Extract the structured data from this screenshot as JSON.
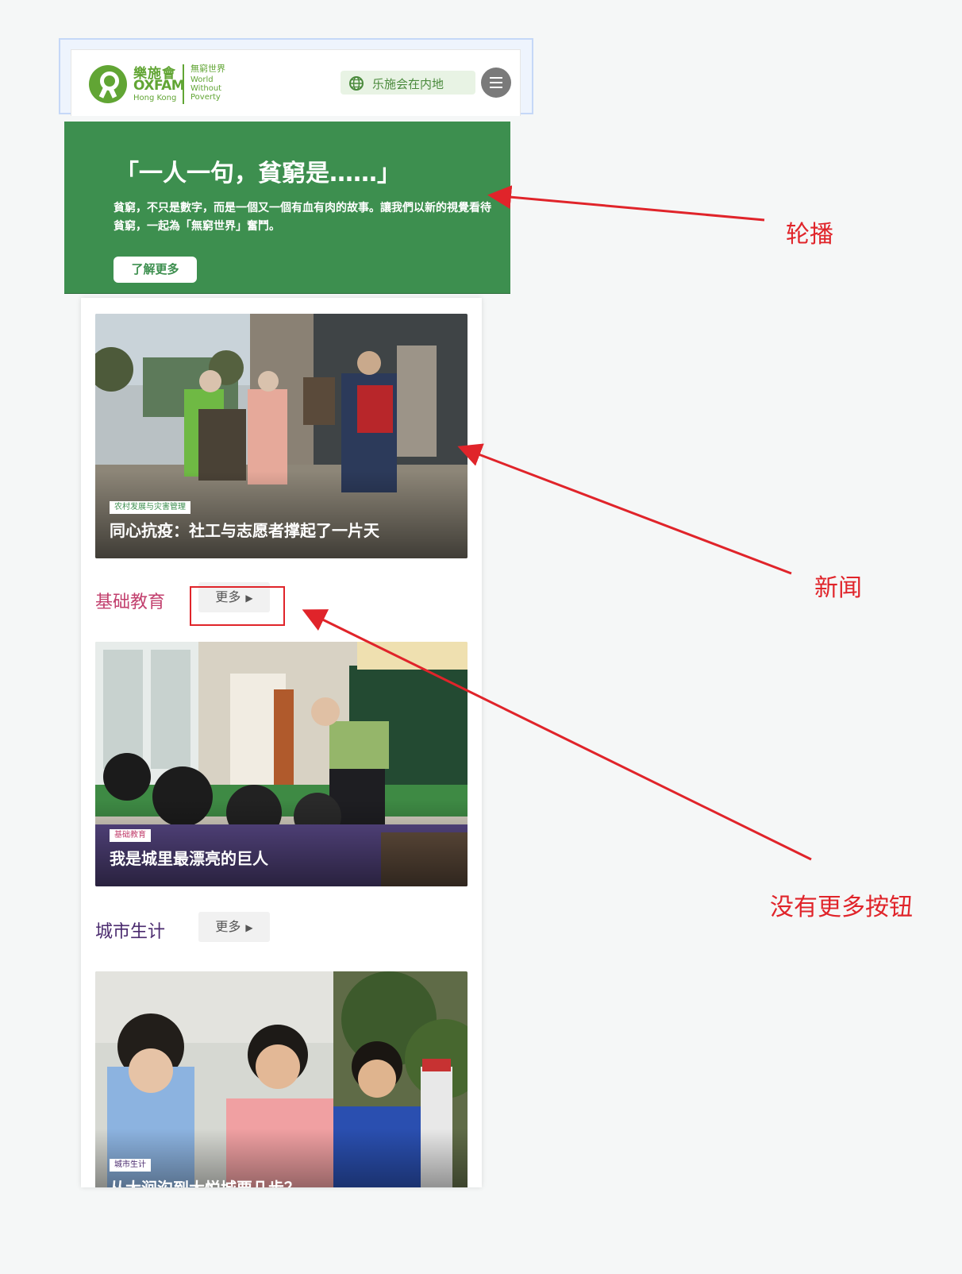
{
  "header": {
    "logo_cn": "樂施會",
    "logo_en": "OXFAM",
    "logo_sub": "Hong Kong",
    "tagline_cn": "無窮世界",
    "tagline_en": "World Without Poverty",
    "region_label": "乐施会在内地",
    "brand_color": "#61a534"
  },
  "carousel": {
    "title": "「一人一句，貧窮是……」",
    "text": "貧窮，不只是數字，而是一個又一個有血有肉的故事。讓我們以新的視覺看待貧窮，一起為「無窮世界」奮鬥。",
    "button": "了解更多",
    "background": "#3d8f4f"
  },
  "news": {
    "category": "农村发展与灾害管理",
    "caption": "同心抗疫：社工与志愿者撑起了一片天"
  },
  "sections": [
    {
      "title": "基础教育",
      "more": "更多",
      "color": "#c2406e",
      "item": {
        "category": "基础教育",
        "caption": "我是城里最漂亮的巨人"
      }
    },
    {
      "title": "城市生计",
      "more": "更多",
      "color": "#4a2a6e",
      "item": {
        "category": "城市生计",
        "caption": "从大涧沟到大悦城要几步？"
      }
    }
  ],
  "annotations": {
    "carousel": "轮播",
    "news": "新闻",
    "no_more": "没有更多按钮",
    "color": "#e0242a"
  }
}
